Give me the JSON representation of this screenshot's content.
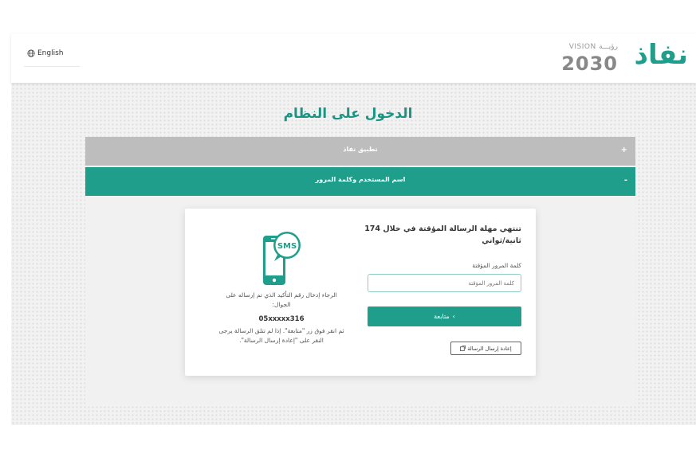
{
  "header": {
    "language_link": "English",
    "logo_text": "نفاذ",
    "vision_top": "VISION رؤيـــة",
    "vision_year": "2030"
  },
  "page": {
    "title": "الدخول على النظام"
  },
  "accordion": {
    "item1": {
      "label": "تطبيق نفاذ",
      "sign": "+"
    },
    "item2": {
      "label": "اسم المستخدم وكلمة المرور",
      "sign": "-"
    }
  },
  "otp": {
    "timer_text": "تنتهي مهلة الرسالة المؤقتة في خلال 174 ثانية/ثواني",
    "password_label": "كلمة المرور المؤقتة",
    "password_placeholder": "كلمة المرور المؤقتة",
    "continue_label": "متابعة",
    "continue_arrow": "›",
    "resend_label": "إعادة إرسال الرسالة",
    "sms_badge": "SMS",
    "instruction": "الرجاء إدخال رقم التأكيد الذي تم إرساله على الجوال:",
    "phone_number": "05xxxxx316",
    "help_text": "ثم انقر فوق زر \"متابعة\". إذا لم تتلق الرسالة يرجى النقر على \"إعادة إرسال الرسالة\"."
  },
  "colors": {
    "accent": "#1f9e8c",
    "inactive_tab": "#bdbdbd"
  }
}
